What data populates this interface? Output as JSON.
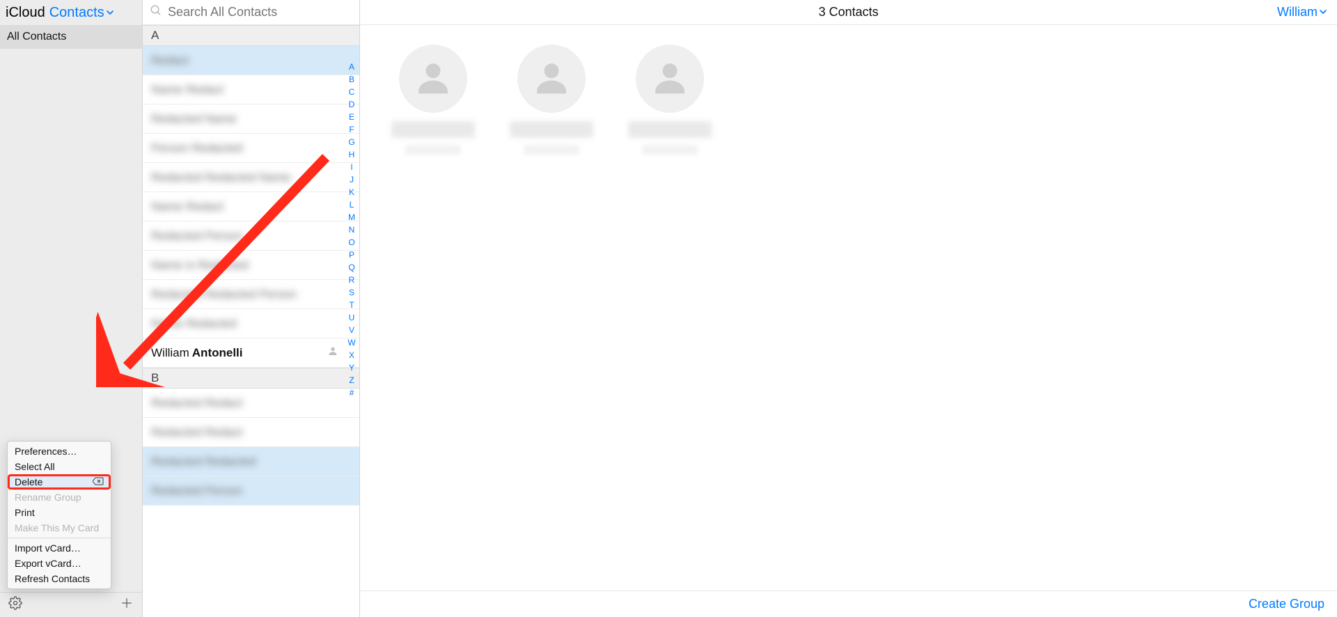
{
  "sidebar": {
    "brand": "iCloud",
    "app_switcher_label": "Contacts",
    "groups": [
      {
        "label": "All Contacts",
        "selected": true
      }
    ]
  },
  "search": {
    "placeholder": "Search All Contacts",
    "value": ""
  },
  "context_menu": {
    "items": [
      {
        "label": "Preferences…",
        "enabled": true,
        "highlighted": false
      },
      {
        "label": "Select All",
        "enabled": true,
        "highlighted": false
      },
      {
        "label": "Delete",
        "enabled": true,
        "highlighted": true,
        "shortcut_icon": "backspace"
      },
      {
        "label": "Rename Group",
        "enabled": false,
        "highlighted": false
      },
      {
        "label": "Print",
        "enabled": true,
        "highlighted": false
      },
      {
        "label": "Make This My Card",
        "enabled": false,
        "highlighted": false
      },
      {
        "separator": true
      },
      {
        "label": "Import vCard…",
        "enabled": true,
        "highlighted": false
      },
      {
        "label": "Export vCard…",
        "enabled": true,
        "highlighted": false
      },
      {
        "label": "Refresh Contacts",
        "enabled": true,
        "highlighted": false
      }
    ]
  },
  "contact_list": {
    "sections": [
      {
        "letter": "A",
        "rows": [
          {
            "redacted": true,
            "selected": true
          },
          {
            "redacted": true,
            "selected": false
          },
          {
            "redacted": true,
            "selected": false
          },
          {
            "redacted": true,
            "selected": false
          },
          {
            "redacted": true,
            "selected": false
          },
          {
            "redacted": true,
            "selected": false
          },
          {
            "redacted": true,
            "selected": false
          },
          {
            "redacted": true,
            "selected": false
          },
          {
            "redacted": true,
            "selected": false
          },
          {
            "redacted": true,
            "selected": false
          },
          {
            "first": "William",
            "last": "Antonelli",
            "me": true,
            "selected": false
          }
        ]
      },
      {
        "letter": "B",
        "rows": [
          {
            "redacted": true,
            "selected": false
          },
          {
            "redacted": true,
            "selected": false
          },
          {
            "redacted": true,
            "selected": true
          },
          {
            "redacted": true,
            "selected": true
          }
        ]
      }
    ],
    "az_index": [
      "A",
      "B",
      "C",
      "D",
      "E",
      "F",
      "G",
      "H",
      "I",
      "J",
      "K",
      "L",
      "M",
      "N",
      "O",
      "P",
      "Q",
      "R",
      "S",
      "T",
      "U",
      "V",
      "W",
      "X",
      "Y",
      "Z",
      "#"
    ]
  },
  "detail": {
    "count_label": "3 Contacts",
    "user_menu_label": "William",
    "selected_cards": [
      {
        "redacted": true
      },
      {
        "redacted": true
      },
      {
        "redacted": true
      }
    ],
    "create_group_label": "Create Group"
  },
  "colors": {
    "accent": "#007aff",
    "annotation": "#ff2a1a"
  }
}
